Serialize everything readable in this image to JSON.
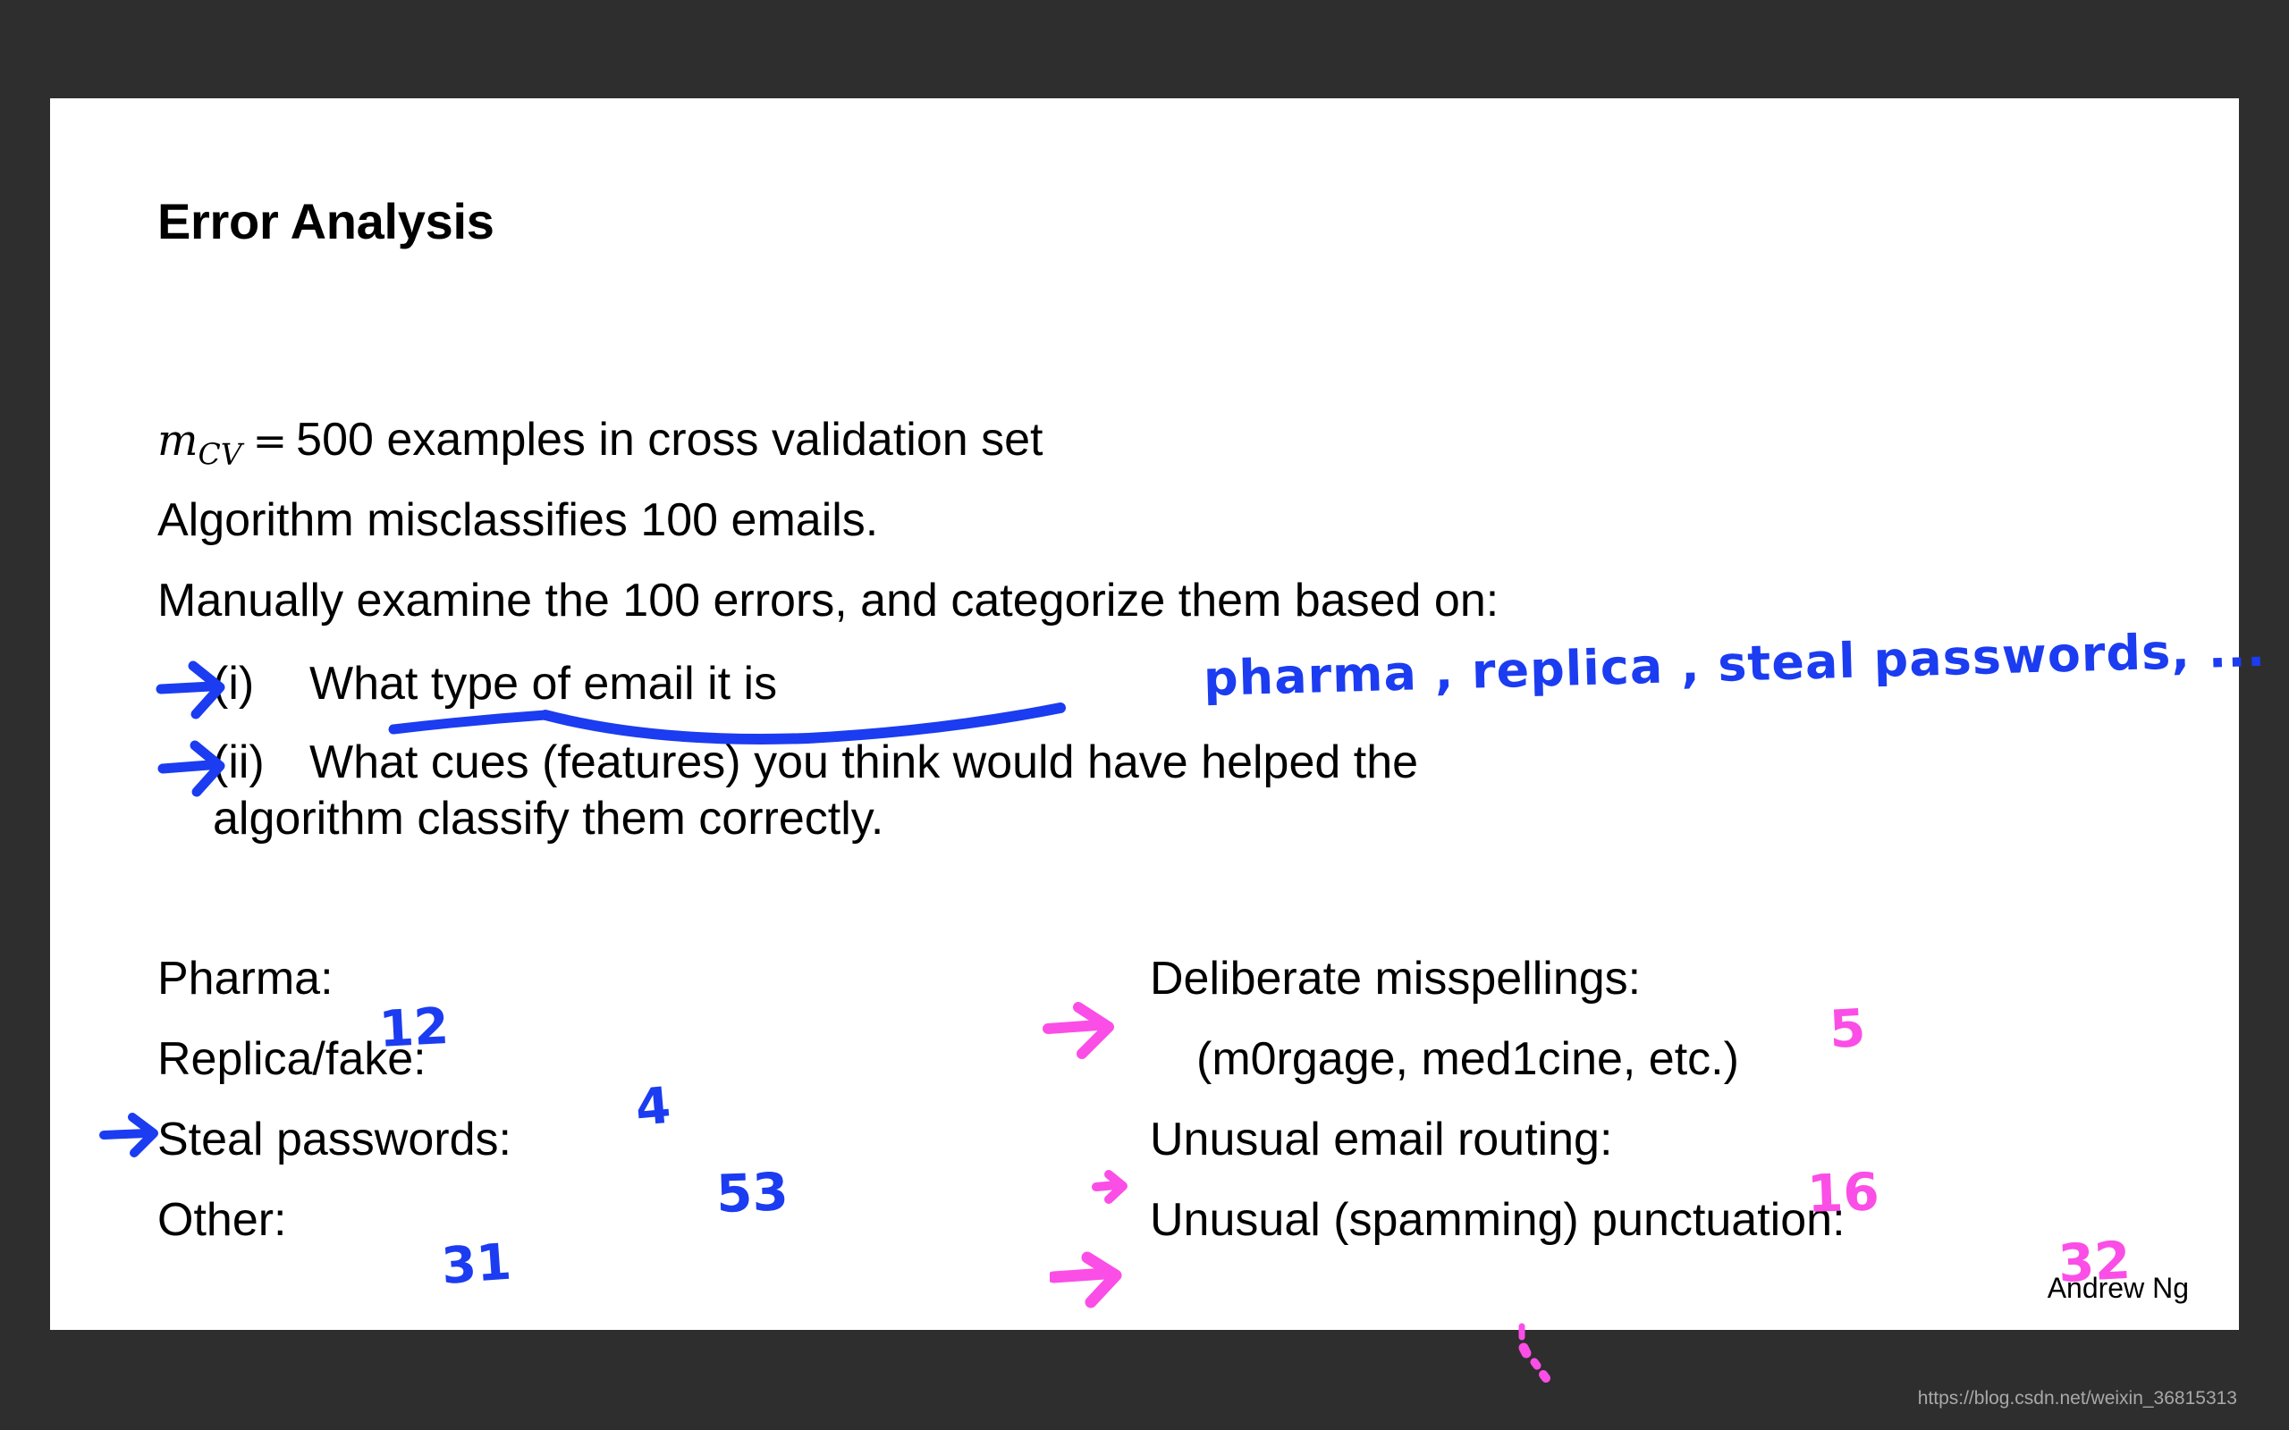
{
  "slide": {
    "title": "Error Analysis",
    "lines": {
      "mcv_var": "m",
      "mcv_sub": "CV",
      "mcv_eq": "=",
      "mcv_rest": "500 examples in cross validation set",
      "algorithm": "Algorithm misclassifies 100 emails.",
      "manual": "Manually examine the 100 errors, and categorize them based on:"
    },
    "items": [
      {
        "marker": "(i)",
        "text": "What type of email it is",
        "underlined_word": "type",
        "arrow_color": "#1b3cf0",
        "annotation": "pharma , replica , steal passwords, ...",
        "annotation_color": "#1b3cf0"
      },
      {
        "marker": "(ii)",
        "text": "What cues (features) you think would have helped the",
        "text_second_line": "algorithm classify them correctly.",
        "arrow_color": "#1b3cf0"
      }
    ],
    "left_list": [
      {
        "label": "Pharma:",
        "count": "12",
        "count_color": "#1b3cf0",
        "has_arrow": false
      },
      {
        "label": "Replica/fake:",
        "count": "4",
        "count_color": "#1b3cf0",
        "has_arrow": false
      },
      {
        "label": "Steal passwords:",
        "count": "53",
        "count_color": "#1b3cf0",
        "has_arrow": true
      },
      {
        "label": "Other:",
        "count": "31",
        "count_color": "#1b3cf0",
        "has_arrow": false
      }
    ],
    "right_list": [
      {
        "label": "Deliberate misspellings:",
        "count": "5",
        "count_color": "#fb4ee6",
        "has_arrow": true
      },
      {
        "label": "(m0rgage, med1cine, etc.)",
        "count": "",
        "count_color": "",
        "has_arrow": false
      },
      {
        "label": "Unusual email routing:",
        "count": "16",
        "count_color": "#fb4ee6",
        "has_arrow": true
      },
      {
        "label": "Unusual (spamming) punctuation:",
        "count": "32",
        "count_color": "#fb4ee6",
        "has_arrow": true
      }
    ],
    "footer": "Andrew Ng",
    "watermark": "https://blog.csdn.net/weixin_36815313"
  },
  "colors": {
    "background": "#2e2e2e",
    "slide": "#ffffff",
    "text": "#000000",
    "ink_blue": "#1b3cf0",
    "ink_magenta": "#fb4ee6",
    "watermark": "#a8a8a8"
  }
}
